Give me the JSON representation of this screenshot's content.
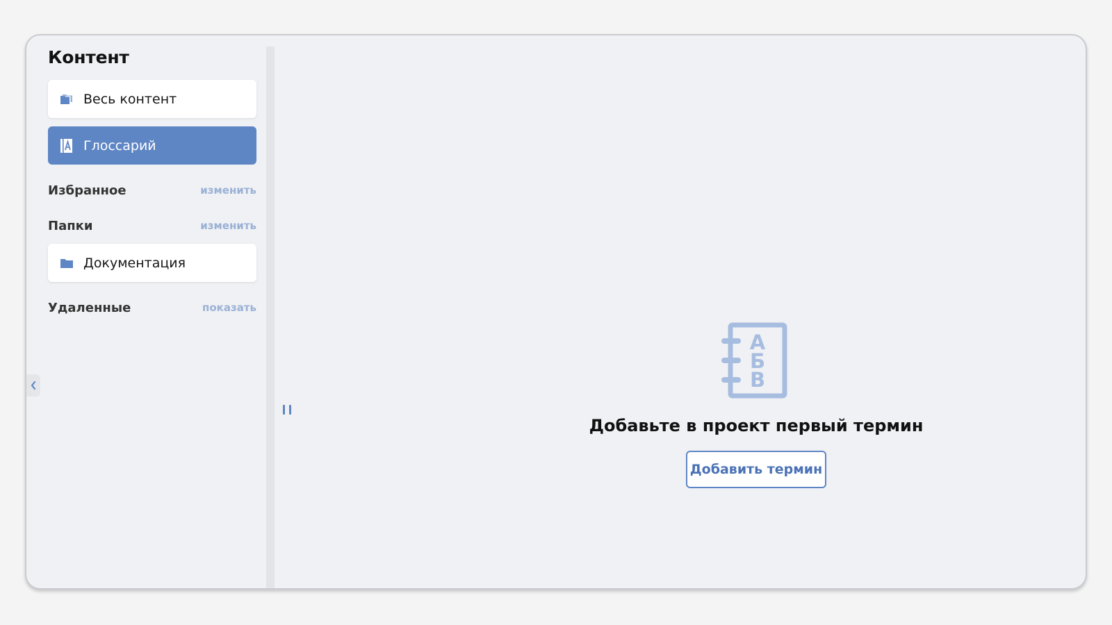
{
  "sidebar": {
    "title": "Контент",
    "items": [
      {
        "label": "Весь контент",
        "icon": "stack-folder-icon",
        "active": false
      },
      {
        "label": "Глоссарий",
        "icon": "glossary-book-icon",
        "active": true
      }
    ],
    "favorites": {
      "title": "Избранное",
      "action": "изменить"
    },
    "folders": {
      "title": "Папки",
      "action": "изменить",
      "items": [
        {
          "label": "Документация",
          "icon": "folder-icon"
        }
      ]
    },
    "deleted": {
      "title": "Удаленные",
      "action": "показать"
    }
  },
  "empty_state": {
    "illustration_letters": [
      "А",
      "Б",
      "В"
    ],
    "title": "Добавьте в проект первый термин",
    "button_label": "Добавить термин"
  },
  "colors": {
    "accent": "#5e85c4",
    "accent_text": "#4a72b6",
    "muted_link": "#9ab1d6",
    "illustration": "#a7bde0",
    "panel_bg": "#f0f1f4"
  }
}
